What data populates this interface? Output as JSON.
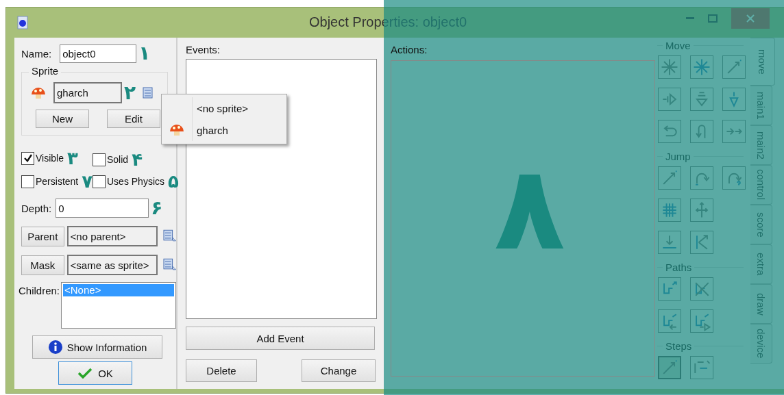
{
  "window": {
    "title": "Object Properties: object0"
  },
  "properties": {
    "name_label": "Name:",
    "name_value": "object0",
    "name_mark": "۱",
    "sprite_group": "Sprite",
    "sprite_value": "gharch",
    "sprite_mark": "۲",
    "sprite_buttons": [
      "New",
      "Edit"
    ],
    "checkboxes": [
      {
        "label": "Visible",
        "checked": true,
        "mark": "۳"
      },
      {
        "label": "Solid",
        "checked": false,
        "mark": "۴"
      },
      {
        "label": "Persistent",
        "checked": false,
        "mark": "۷"
      },
      {
        "label": "Uses Physics",
        "checked": false,
        "mark": "۵"
      }
    ],
    "depth_label": "Depth:",
    "depth_value": "0",
    "depth_mark": "۶",
    "parent_button": "Parent",
    "parent_value": "<no parent>",
    "mask_button": "Mask",
    "mask_value": "<same as sprite>",
    "children_label": "Children:",
    "children": [
      {
        "label": "<None>",
        "selected": true
      }
    ],
    "show_information": "Show Information",
    "ok": "OK"
  },
  "sprite_menu": [
    {
      "label": "<no sprite>",
      "kind": "plain"
    },
    {
      "label": "gharch",
      "kind": "sprite"
    }
  ],
  "events": {
    "label": "Events:",
    "add_event": "Add Event",
    "delete": "Delete",
    "change": "Change"
  },
  "actions": {
    "label": "Actions:",
    "mark": "۸"
  },
  "palette": [
    {
      "title": "Move",
      "rows": [
        [
          {
            "kind": "star"
          },
          {
            "kind": "star-blue"
          },
          {
            "kind": "dot-arrow"
          }
        ],
        [
          {
            "kind": "push-right"
          },
          {
            "kind": "down-grey"
          },
          {
            "kind": "down-blue"
          }
        ],
        [
          {
            "kind": "bounce"
          },
          {
            "kind": "uturn"
          },
          {
            "kind": "double-arrow"
          }
        ]
      ]
    },
    {
      "title": "Jump",
      "rows": [
        [
          {
            "kind": "dot-arrow"
          },
          {
            "kind": "arc"
          },
          {
            "kind": "arc-question"
          }
        ],
        [
          {
            "kind": "grid"
          },
          {
            "kind": "cross-arrows"
          }
        ],
        [
          {
            "kind": "down-bar"
          },
          {
            "kind": "k-arrow"
          }
        ]
      ]
    },
    {
      "title": "Paths",
      "rows": [
        [
          {
            "kind": "path"
          },
          {
            "kind": "path-cross"
          }
        ],
        [
          {
            "kind": "path-back"
          },
          {
            "kind": "path-forward"
          }
        ]
      ]
    },
    {
      "title": "Steps",
      "rows": [
        [
          {
            "kind": "dot-arrow",
            "selected": true
          },
          {
            "kind": "steps",
            "selected": false
          }
        ]
      ]
    }
  ],
  "tabs": [
    {
      "label": "move",
      "selected": true
    },
    {
      "label": "main1",
      "selected": false
    },
    {
      "label": "main2",
      "selected": false
    },
    {
      "label": "control",
      "selected": false
    },
    {
      "label": "score",
      "selected": false
    },
    {
      "label": "extra",
      "selected": false
    },
    {
      "label": "draw",
      "selected": false
    },
    {
      "label": "device",
      "selected": false
    }
  ]
}
